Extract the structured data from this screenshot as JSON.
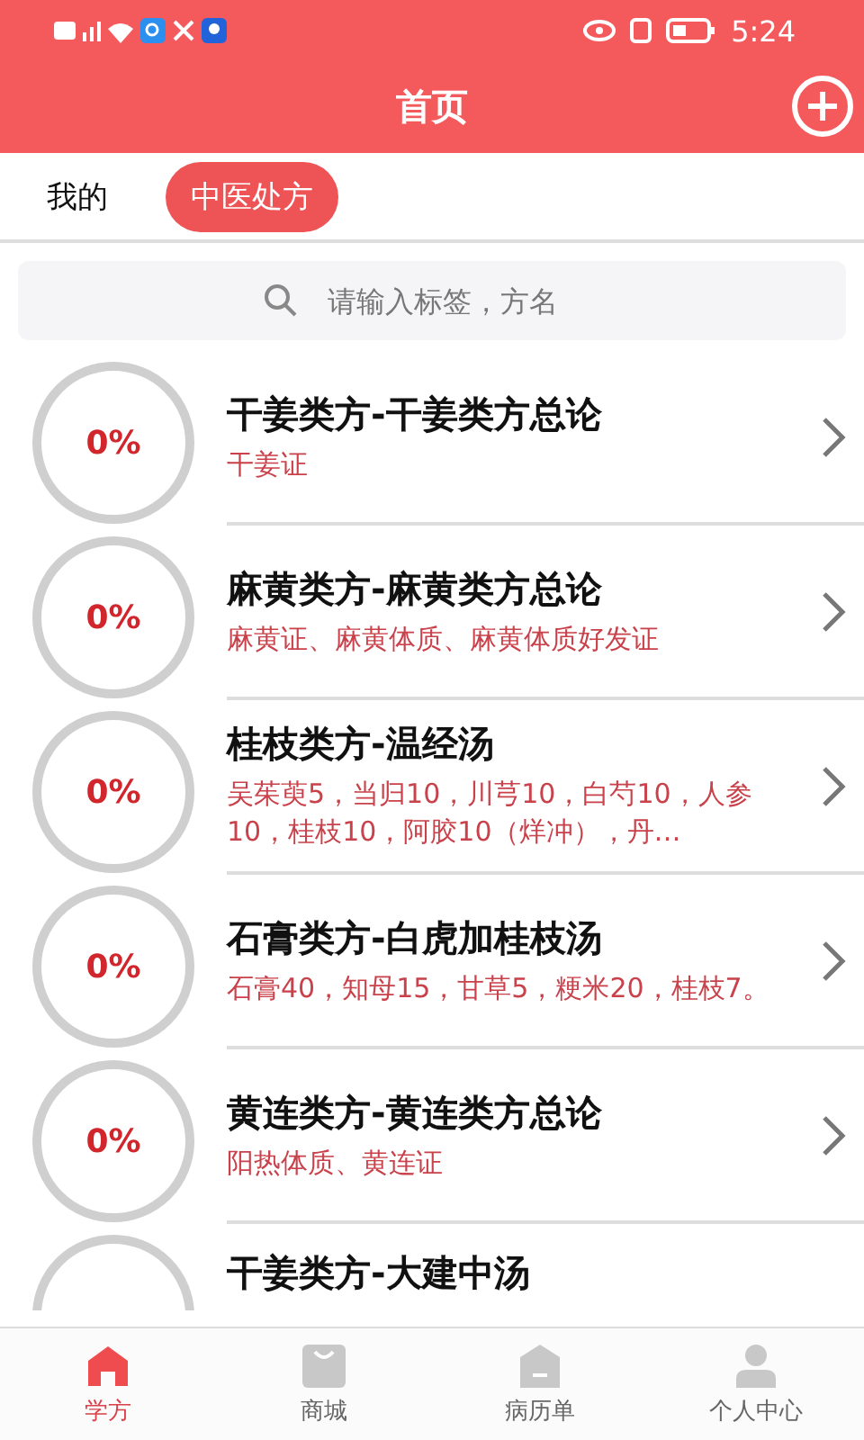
{
  "status_bar": {
    "time": "5:24"
  },
  "header": {
    "title": "首页"
  },
  "tabs": [
    {
      "label": "我的",
      "selected": false
    },
    {
      "label": "中医处方",
      "selected": true
    }
  ],
  "search": {
    "placeholder": "请输入标签，方名"
  },
  "items": [
    {
      "progress": "0%",
      "title": "干姜类方-干姜类方总论",
      "subtitle": "干姜证"
    },
    {
      "progress": "0%",
      "title": "麻黄类方-麻黄类方总论",
      "subtitle": "麻黄证、麻黄体质、麻黄体质好发证"
    },
    {
      "progress": "0%",
      "title": "桂枝类方-温经汤",
      "subtitle": "吴茱萸5，当归10，川芎10，白芍10，人参10，桂枝10，阿胶10（烊冲），丹…"
    },
    {
      "progress": "0%",
      "title": "石膏类方-白虎加桂枝汤",
      "subtitle": "石膏40，知母15，甘草5，粳米20，桂枝7。"
    },
    {
      "progress": "0%",
      "title": "黄连类方-黄连类方总论",
      "subtitle": "阳热体质、黄连证"
    },
    {
      "title": "干姜类方-大建中汤"
    }
  ],
  "nav": [
    {
      "label": "学方",
      "kind": "home",
      "selected": true
    },
    {
      "label": "商城",
      "kind": "shop",
      "selected": false
    },
    {
      "label": "病历单",
      "kind": "record",
      "selected": false
    },
    {
      "label": "个人中心",
      "kind": "person",
      "selected": false
    }
  ]
}
